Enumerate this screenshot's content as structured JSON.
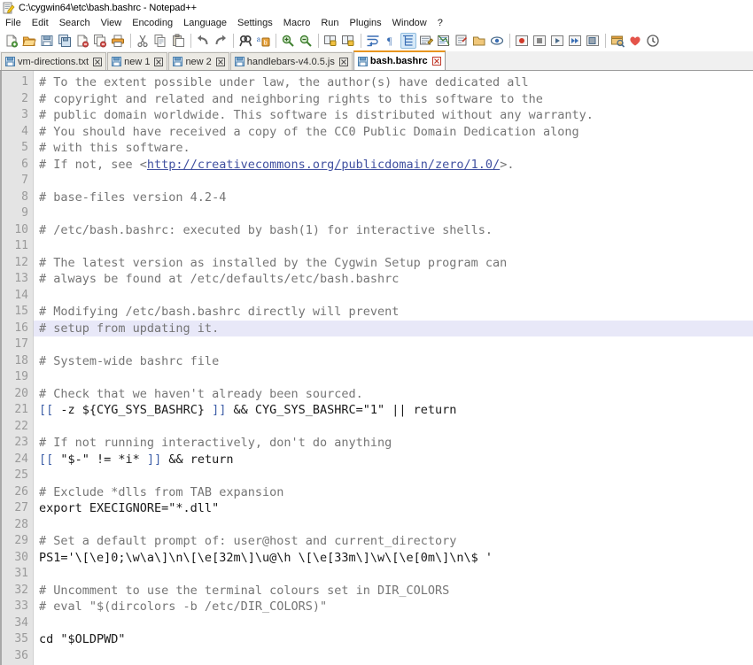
{
  "window": {
    "title": "C:\\cygwin64\\etc\\bash.bashrc - Notepad++",
    "icon": "notepad-plus-plus-icon"
  },
  "menubar": {
    "items": [
      {
        "label": "File"
      },
      {
        "label": "Edit"
      },
      {
        "label": "Search"
      },
      {
        "label": "View"
      },
      {
        "label": "Encoding"
      },
      {
        "label": "Language"
      },
      {
        "label": "Settings"
      },
      {
        "label": "Macro"
      },
      {
        "label": "Run"
      },
      {
        "label": "Plugins"
      },
      {
        "label": "Window"
      },
      {
        "label": "?"
      }
    ]
  },
  "toolbar": {
    "buttons": [
      {
        "name": "new-file-icon",
        "group": 0
      },
      {
        "name": "open-file-icon",
        "group": 0
      },
      {
        "name": "save-icon",
        "group": 0
      },
      {
        "name": "save-all-icon",
        "group": 0
      },
      {
        "name": "close-file-icon",
        "group": 0
      },
      {
        "name": "close-all-files-icon",
        "group": 0
      },
      {
        "name": "print-icon",
        "group": 0
      },
      {
        "name": "cut-icon",
        "group": 1
      },
      {
        "name": "copy-icon",
        "group": 1
      },
      {
        "name": "paste-icon",
        "group": 1
      },
      {
        "name": "undo-icon",
        "group": 2
      },
      {
        "name": "redo-icon",
        "group": 2
      },
      {
        "name": "find-icon",
        "group": 3
      },
      {
        "name": "replace-icon",
        "group": 3
      },
      {
        "name": "zoom-in-icon",
        "group": 4
      },
      {
        "name": "zoom-out-icon",
        "group": 4
      },
      {
        "name": "sync-vertical-scroll-icon",
        "group": 5
      },
      {
        "name": "sync-horizontal-scroll-icon",
        "group": 5
      },
      {
        "name": "word-wrap-icon",
        "group": 6
      },
      {
        "name": "show-all-characters-icon",
        "group": 6
      },
      {
        "name": "indent-guideline-icon",
        "group": 6,
        "active": true
      },
      {
        "name": "user-defined-language-icon",
        "group": 6
      },
      {
        "name": "document-map-icon",
        "group": 6
      },
      {
        "name": "function-list-icon",
        "group": 6
      },
      {
        "name": "folder-as-workspace-icon",
        "group": 6
      },
      {
        "name": "monitoring-icon",
        "group": 6
      },
      {
        "name": "record-macro-icon",
        "group": 7
      },
      {
        "name": "stop-recording-icon",
        "group": 7
      },
      {
        "name": "play-macro-icon",
        "group": 7
      },
      {
        "name": "run-macro-multiple-icon",
        "group": 7
      },
      {
        "name": "save-macro-icon",
        "group": 7
      },
      {
        "name": "run-icon",
        "group": 8
      },
      {
        "name": "donate-heart-icon",
        "group": 8
      },
      {
        "name": "clock-icon",
        "group": 8
      }
    ]
  },
  "tabs": [
    {
      "label": "vm-directions.txt",
      "active": false,
      "icon": "saved-document-icon"
    },
    {
      "label": "new 1",
      "active": false,
      "icon": "saved-document-icon"
    },
    {
      "label": "new 2",
      "active": false,
      "icon": "saved-document-icon"
    },
    {
      "label": "handlebars-v4.0.5.js",
      "active": false,
      "icon": "saved-document-icon"
    },
    {
      "label": "bash.bashrc",
      "active": true,
      "icon": "saved-document-icon"
    }
  ],
  "editor": {
    "current_line": 16,
    "total_lines": 36,
    "lines": [
      {
        "n": 1,
        "segments": [
          {
            "t": "# To the extent possible under law, the author(s) have dedicated all",
            "c": "comment"
          }
        ]
      },
      {
        "n": 2,
        "segments": [
          {
            "t": "# copyright and related and neighboring rights to this software to the",
            "c": "comment"
          }
        ]
      },
      {
        "n": 3,
        "segments": [
          {
            "t": "# public domain worldwide. This software is distributed without any warranty.",
            "c": "comment"
          }
        ]
      },
      {
        "n": 4,
        "segments": [
          {
            "t": "# You should have received a copy of the CC0 Public Domain Dedication along",
            "c": "comment"
          }
        ]
      },
      {
        "n": 5,
        "segments": [
          {
            "t": "# with this software.",
            "c": "comment"
          }
        ]
      },
      {
        "n": 6,
        "segments": [
          {
            "t": "# If not, see <",
            "c": "comment"
          },
          {
            "t": "http://creativecommons.org/publicdomain/zero/1.0/",
            "c": "link"
          },
          {
            "t": ">.",
            "c": "comment"
          }
        ]
      },
      {
        "n": 7,
        "segments": []
      },
      {
        "n": 8,
        "segments": [
          {
            "t": "# base-files version 4.2-4",
            "c": "comment"
          }
        ]
      },
      {
        "n": 9,
        "segments": []
      },
      {
        "n": 10,
        "segments": [
          {
            "t": "# /etc/bash.bashrc: executed by bash(1) for interactive shells.",
            "c": "comment"
          }
        ]
      },
      {
        "n": 11,
        "segments": []
      },
      {
        "n": 12,
        "segments": [
          {
            "t": "# The latest version as installed by the Cygwin Setup program can",
            "c": "comment"
          }
        ]
      },
      {
        "n": 13,
        "segments": [
          {
            "t": "# always be found at /etc/defaults/etc/bash.bashrc",
            "c": "comment"
          }
        ]
      },
      {
        "n": 14,
        "segments": []
      },
      {
        "n": 15,
        "segments": [
          {
            "t": "# Modifying /etc/bash.bashrc directly will prevent",
            "c": "comment"
          }
        ]
      },
      {
        "n": 16,
        "segments": [
          {
            "t": "# setup from updating it.",
            "c": "comment"
          }
        ]
      },
      {
        "n": 17,
        "segments": []
      },
      {
        "n": 18,
        "segments": [
          {
            "t": "# System-wide bashrc file",
            "c": "comment"
          }
        ]
      },
      {
        "n": 19,
        "segments": []
      },
      {
        "n": 20,
        "segments": [
          {
            "t": "# Check that we haven't already been sourced.",
            "c": "comment"
          }
        ]
      },
      {
        "n": 21,
        "segments": [
          {
            "t": "[[",
            "c": "op"
          },
          {
            "t": " -z ${CYG_SYS_BASHRC} ",
            "c": "plain"
          },
          {
            "t": "]]",
            "c": "op"
          },
          {
            "t": " && CYG_SYS_BASHRC=\"1\" || return",
            "c": "plain"
          }
        ]
      },
      {
        "n": 22,
        "segments": []
      },
      {
        "n": 23,
        "segments": [
          {
            "t": "# If not running interactively, don't do anything",
            "c": "comment"
          }
        ]
      },
      {
        "n": 24,
        "segments": [
          {
            "t": "[[",
            "c": "op"
          },
          {
            "t": " \"$-\" != *i* ",
            "c": "plain"
          },
          {
            "t": "]]",
            "c": "op"
          },
          {
            "t": " && return",
            "c": "plain"
          }
        ]
      },
      {
        "n": 25,
        "segments": []
      },
      {
        "n": 26,
        "segments": [
          {
            "t": "# Exclude *dlls from TAB expansion",
            "c": "comment"
          }
        ]
      },
      {
        "n": 27,
        "segments": [
          {
            "t": "export EXECIGNORE=\"*.dll\"",
            "c": "plain"
          }
        ]
      },
      {
        "n": 28,
        "segments": []
      },
      {
        "n": 29,
        "segments": [
          {
            "t": "# Set a default prompt of: user@host and current_directory",
            "c": "comment"
          }
        ]
      },
      {
        "n": 30,
        "segments": [
          {
            "t": "PS1='\\[\\e]0;\\w\\a\\]\\n\\[\\e[32m\\]\\u@\\h \\[\\e[33m\\]\\w\\[\\e[0m\\]\\n\\$ '",
            "c": "plain"
          }
        ]
      },
      {
        "n": 31,
        "segments": []
      },
      {
        "n": 32,
        "segments": [
          {
            "t": "# Uncomment to use the terminal colours set in DIR_COLORS",
            "c": "comment"
          }
        ]
      },
      {
        "n": 33,
        "segments": [
          {
            "t": "# eval \"$(dircolors -b /etc/DIR_COLORS)\"",
            "c": "comment"
          }
        ]
      },
      {
        "n": 34,
        "segments": []
      },
      {
        "n": 35,
        "segments": [
          {
            "t": "cd \"$OLDPWD\"",
            "c": "plain"
          }
        ]
      },
      {
        "n": 36,
        "segments": []
      }
    ]
  },
  "colors": {
    "accent_tab": "#e8951e",
    "comment": "#757575",
    "operator": "#4060a8",
    "link": "#4050a0",
    "current_line_bg": "#e8e8f8",
    "gutter_bg": "#e4e4e4"
  }
}
